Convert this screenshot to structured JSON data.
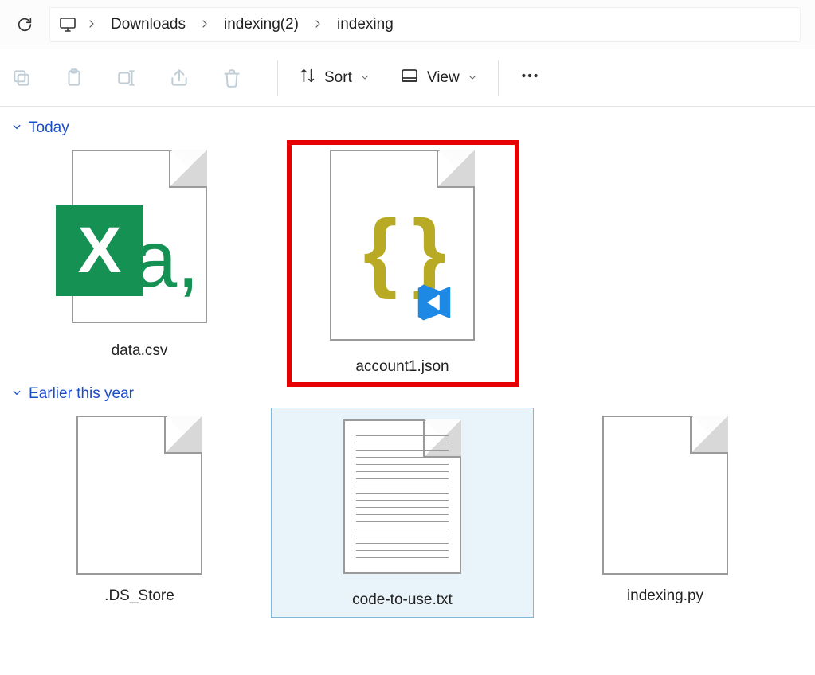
{
  "breadcrumb": {
    "segments": [
      "Downloads",
      "indexing(2)",
      "indexing"
    ]
  },
  "toolbar": {
    "sort_label": "Sort",
    "view_label": "View"
  },
  "groups": [
    {
      "label": "Today",
      "files": [
        {
          "name": "data.csv",
          "icon": "csv",
          "highlighted": false,
          "selected": false
        },
        {
          "name": "account1.json",
          "icon": "json",
          "highlighted": true,
          "selected": false
        }
      ]
    },
    {
      "label": "Earlier this year",
      "files": [
        {
          "name": ".DS_Store",
          "icon": "blank",
          "highlighted": false,
          "selected": false
        },
        {
          "name": "code-to-use.txt",
          "icon": "txt",
          "highlighted": false,
          "selected": true
        },
        {
          "name": "indexing.py",
          "icon": "blank",
          "highlighted": false,
          "selected": false
        }
      ]
    }
  ]
}
